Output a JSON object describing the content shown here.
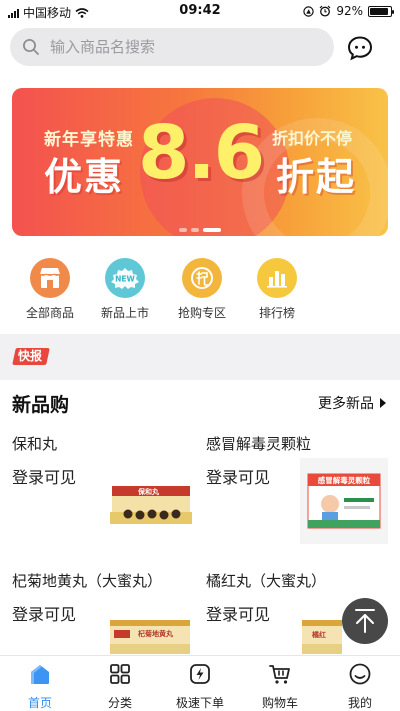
{
  "status_bar": {
    "carrier": "中国移动",
    "time": "09:42",
    "battery": "92%",
    "battery_level": 0.92
  },
  "search": {
    "placeholder": "输入商品名搜索"
  },
  "banner": {
    "left_top": "新年享特惠",
    "left_big": "优惠",
    "number": "8.6",
    "right_top": "折扣价不停",
    "right_big": "折起",
    "active_dot": 2,
    "dot_count": 3
  },
  "categories": [
    {
      "label": "全部商品",
      "icon": "store-icon",
      "color": "#f08a4b"
    },
    {
      "label": "新品上市",
      "icon": "new-icon",
      "color": "#5fc7d6"
    },
    {
      "label": "抢购专区",
      "icon": "flash-sale-icon",
      "color": "#f2b63c"
    },
    {
      "label": "排行榜",
      "icon": "ranking-icon",
      "color": "#f5c83d"
    }
  ],
  "news": {
    "badge": "快报"
  },
  "new_products": {
    "title": "新品购",
    "more": "更多新品",
    "items": [
      {
        "name": "保和丸",
        "price_text": "登录可见"
      },
      {
        "name": "感冒解毒灵颗粒",
        "price_text": "登录可见"
      },
      {
        "name": "杞菊地黄丸（大蜜丸）",
        "price_text": "登录可见"
      },
      {
        "name": "橘红丸（大蜜丸）",
        "price_text": "登录可见"
      }
    ]
  },
  "packaging": {
    "baohe": "保和丸",
    "ganmao": "感冒解毒灵颗粒",
    "qiju": "杞菊地黄丸",
    "juhong": "橘红"
  },
  "tab_bar": {
    "items": [
      {
        "label": "首页",
        "active": true
      },
      {
        "label": "分类",
        "active": false
      },
      {
        "label": "极速下单",
        "active": false
      },
      {
        "label": "购物车",
        "active": false
      },
      {
        "label": "我的",
        "active": false
      }
    ]
  },
  "colors": {
    "accent": "#2f8ff0",
    "banner_red": "#f4524f",
    "news_badge": "#e8473d"
  }
}
